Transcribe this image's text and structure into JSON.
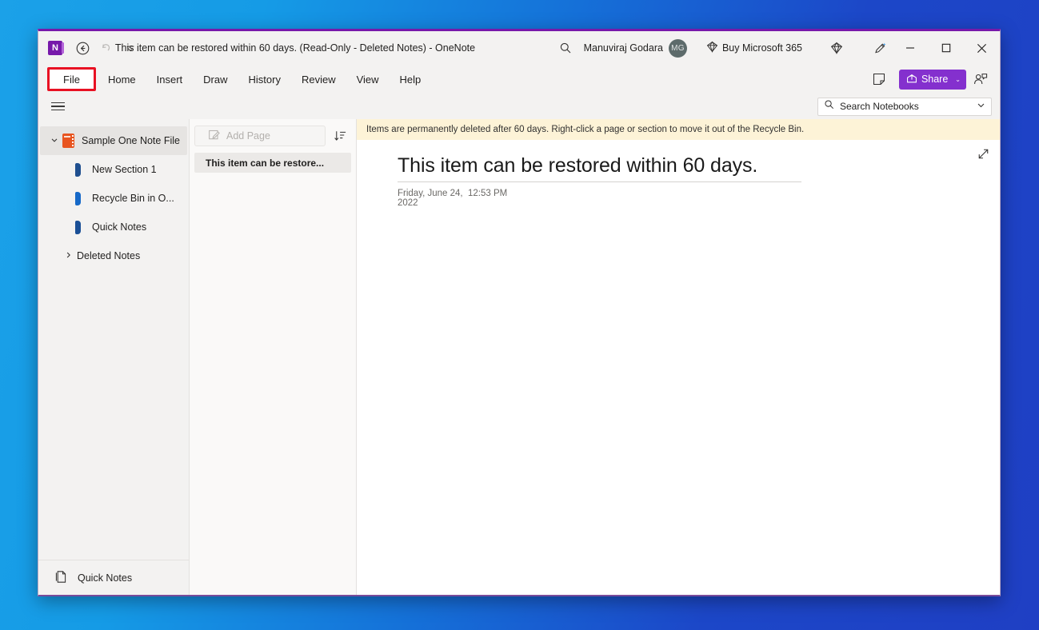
{
  "window": {
    "title": "This item can be restored within 60 days. (Read-Only - Deleted Notes)  -  OneNote",
    "logo_text": "N",
    "accent_purple": "#7719aa",
    "highlight_color": "#e81123"
  },
  "titlebar": {
    "back_icon": "back-arrow-icon",
    "undo_icon": "undo-icon",
    "customize_icon": "customize-quick-access-icon",
    "search_icon": "search-icon",
    "account_name": "Manuviraj Godara",
    "avatar_initials": "MG",
    "buy_label": "Buy Microsoft 365",
    "buy_icon": "diamond-icon",
    "diamond_icon": "diamond-icon",
    "pen_icon": "pen-draw-icon",
    "minimize": "–",
    "maximize": "☐",
    "close": "×"
  },
  "ribbon": {
    "tabs": [
      {
        "label": "File",
        "highlighted": true
      },
      {
        "label": "Home",
        "highlighted": false
      },
      {
        "label": "Insert",
        "highlighted": false
      },
      {
        "label": "Draw",
        "highlighted": false
      },
      {
        "label": "History",
        "highlighted": false
      },
      {
        "label": "Review",
        "highlighted": false
      },
      {
        "label": "View",
        "highlighted": false
      },
      {
        "label": "Help",
        "highlighted": false
      }
    ],
    "notes_icon": "sticky-note-icon",
    "share_label": "Share",
    "share_chevron": "⌄",
    "share_color": "#8430ce",
    "people_icon": "share-people-icon"
  },
  "search": {
    "hamburger_icon": "hamburger-menu-icon",
    "icon": "search-icon",
    "placeholder": "Search Notebooks",
    "chevron": "⌄"
  },
  "sidebar": {
    "notebook": {
      "label": "Sample One Note File",
      "icon": "notebook-icon",
      "chevron": "⌄",
      "expanded": true,
      "color": "#e8541f"
    },
    "sections": [
      {
        "label": "New Section 1",
        "color": "#1f4f8f"
      },
      {
        "label": "Recycle Bin in O...",
        "color": "#1669c8"
      },
      {
        "label": "Quick Notes",
        "color": "#1a4f96"
      }
    ],
    "deleted_notes": {
      "label": "Deleted Notes",
      "chevron": "›"
    },
    "footer": {
      "label": "Quick Notes",
      "icon": "page-icon"
    }
  },
  "pagelist": {
    "add_page_label": "Add Page",
    "add_page_icon": "new-page-icon",
    "add_page_disabled": true,
    "sort_icon": "sort-icon",
    "pages": [
      {
        "label": "This item can be restore...",
        "selected": true
      }
    ]
  },
  "content": {
    "notice": "Items are permanently deleted after 60 days. Right-click a page or section to move it out of the Recycle Bin.",
    "expand_icon": "expand-diagonal-icon",
    "page_title": "This item can be restored within 60 days.",
    "page_date": "Friday, June 24, 2022",
    "page_time": "12:53 PM"
  }
}
